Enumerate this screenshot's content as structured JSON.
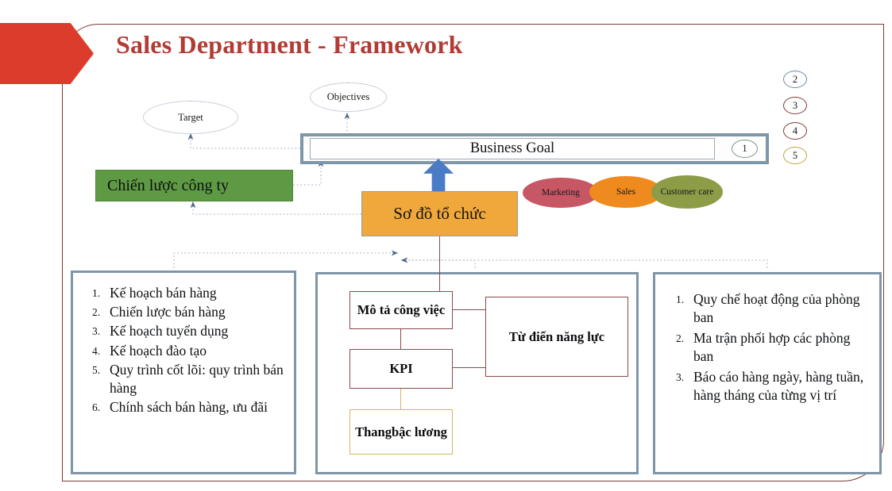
{
  "slide": {
    "title": "Sales Department - Framework",
    "title_color": "#B23B34",
    "banner_color": "#DC3C2C",
    "frame_color": "#7d3a34"
  },
  "ellipses": {
    "target": "Target",
    "objectives": "Objectives"
  },
  "goal": {
    "label": "Business Goal",
    "badge": "1"
  },
  "numbered_circles": [
    {
      "label": "2",
      "color": "#6f86a8"
    },
    {
      "label": "3",
      "color": "#7d3a34"
    },
    {
      "label": "4",
      "color": "#7d3a34"
    },
    {
      "label": "5",
      "color": "#bba53a"
    }
  ],
  "strategy_box": {
    "label": "Chiến lược công ty",
    "color": "#5E9A43"
  },
  "org_box": {
    "label": "Sơ đồ tổ chức",
    "color": "#F0A73C"
  },
  "blobs": [
    {
      "label": "Marketing",
      "color": "#C85765"
    },
    {
      "label": "Sales",
      "color": "#EF8B1E"
    },
    {
      "label": "Customer care",
      "color": "#8C9C47"
    }
  ],
  "panel_left": {
    "items": [
      {
        "num": "1.",
        "text": "Kế hoạch bán hàng"
      },
      {
        "num": "2.",
        "text": "Chiến lược bán hàng"
      },
      {
        "num": "3.",
        "text": "Kế hoạch tuyển dụng"
      },
      {
        "num": "4.",
        "text": "Kế hoạch đào tạo"
      },
      {
        "num": "5.",
        "text": "Quy trình cốt lõi: quy trình bán hàng"
      },
      {
        "num": "6.",
        "text": "Chính sách bán hàng, ưu đãi"
      }
    ]
  },
  "panel_mid": {
    "job_description": "Mô tả công việc",
    "kpi": "KPI",
    "salary_scale": "Thang\nbậc lương",
    "salary_scale_line1": "Thang",
    "salary_scale_line2": "bậc lương",
    "competency_dictionary": "Từ điển năng lực"
  },
  "panel_right": {
    "items": [
      {
        "num": "1.",
        "text": "Quy chế hoạt động của phòng ban"
      },
      {
        "num": "2.",
        "text": "Ma trận phối hợp  các phòng ban"
      },
      {
        "num": "3.",
        "text": "Báo cáo hàng ngày, hàng tuần, hàng tháng của từng vị trí"
      }
    ]
  }
}
